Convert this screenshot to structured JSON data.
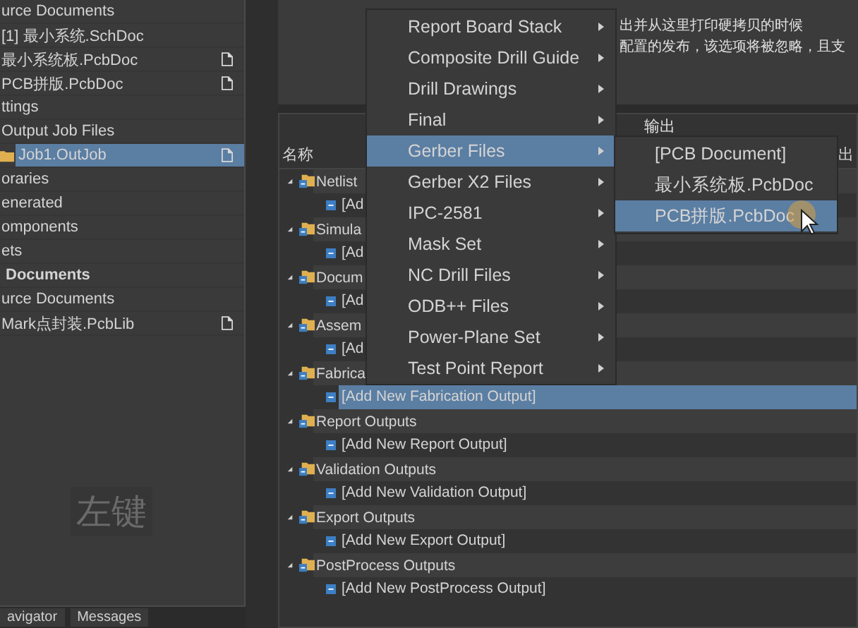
{
  "project_panel": {
    "items": [
      {
        "label": "urce Documents",
        "kind": "group",
        "selected": false
      },
      {
        "label": "[1] 最小系统.SchDoc",
        "kind": "plain",
        "selected": false
      },
      {
        "label": "最小系统板.PcbDoc",
        "kind": "document",
        "selected": false
      },
      {
        "label": "PCB拼版.PcbDoc",
        "kind": "document",
        "selected": false
      },
      {
        "label": "ttings",
        "kind": "group",
        "selected": false
      },
      {
        "label": "Output Job Files",
        "kind": "group",
        "selected": false
      },
      {
        "label": "Job1.OutJob",
        "kind": "job",
        "selected": true
      },
      {
        "label": "oraries",
        "kind": "group",
        "selected": false
      },
      {
        "label": "enerated",
        "kind": "group",
        "selected": false
      },
      {
        "label": "omponents",
        "kind": "group",
        "selected": false
      },
      {
        "label": "ets",
        "kind": "group",
        "selected": false
      },
      {
        "label": "Documents",
        "kind": "header",
        "selected": false
      },
      {
        "label": "urce Documents",
        "kind": "group",
        "selected": false
      },
      {
        "label": "Mark点封装.PcbLib",
        "kind": "document",
        "selected": false
      }
    ],
    "tabs": [
      {
        "label": "avigator",
        "selected": false
      },
      {
        "label": "Messages",
        "selected": false
      }
    ]
  },
  "overlay_caption": "左键",
  "notes": [
    "出并从这里打印硬拷贝的时候",
    "配置的发布，该选项将被忽略，且支"
  ],
  "outputs": {
    "header": "输出",
    "columns": [
      "名称",
      "出"
    ],
    "groups": [
      {
        "label": "Netlist",
        "expanded": true,
        "children": [
          {
            "label": "[Ad",
            "selected": false
          }
        ]
      },
      {
        "label": "Simula",
        "expanded": true,
        "children": [
          {
            "label": "[Ad",
            "selected": false
          }
        ]
      },
      {
        "label": "Docum",
        "expanded": true,
        "children": [
          {
            "label": "[Ad",
            "selected": false
          }
        ]
      },
      {
        "label": "Assem",
        "expanded": true,
        "children": [
          {
            "label": "[Ad",
            "selected": false
          }
        ]
      },
      {
        "label": "Fabrica",
        "expanded": true,
        "children": [
          {
            "label": "[Add New Fabrication Output]",
            "selected": true
          }
        ]
      },
      {
        "label": "Report Outputs",
        "expanded": true,
        "children": [
          {
            "label": "[Add New Report Output]",
            "selected": false
          }
        ]
      },
      {
        "label": "Validation Outputs",
        "expanded": true,
        "children": [
          {
            "label": "[Add New Validation Output]",
            "selected": false
          }
        ]
      },
      {
        "label": "Export Outputs",
        "expanded": true,
        "children": [
          {
            "label": "[Add New Export Output]",
            "selected": false
          }
        ]
      },
      {
        "label": "PostProcess Outputs",
        "expanded": true,
        "children": [
          {
            "label": "[Add New PostProcess Output]",
            "selected": false
          }
        ]
      }
    ]
  },
  "context_menu": {
    "items": [
      {
        "label": "Report Board Stack",
        "selected": false
      },
      {
        "label": "Composite Drill Guide",
        "selected": false
      },
      {
        "label": "Drill Drawings",
        "selected": false
      },
      {
        "label": "Final",
        "selected": false
      },
      {
        "label": "Gerber Files",
        "selected": true
      },
      {
        "label": "Gerber X2 Files",
        "selected": false
      },
      {
        "label": "IPC-2581",
        "selected": false
      },
      {
        "label": "Mask Set",
        "selected": false
      },
      {
        "label": "NC Drill Files",
        "selected": false
      },
      {
        "label": "ODB++ Files",
        "selected": false
      },
      {
        "label": "Power-Plane Set",
        "selected": false
      },
      {
        "label": "Test Point Report",
        "selected": false
      }
    ],
    "submenu": [
      {
        "label": "[PCB Document]",
        "selected": false
      },
      {
        "label": "最小系统板.PcbDoc",
        "selected": false
      },
      {
        "label": "PCB拼版.PcbDoc",
        "selected": true
      }
    ]
  }
}
